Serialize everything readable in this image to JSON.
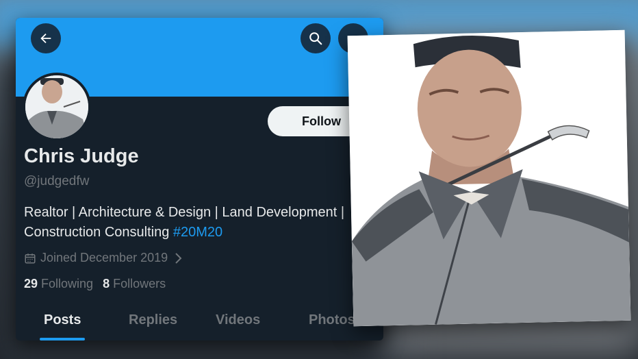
{
  "header": {
    "back_icon": "arrow-left-icon",
    "search_icon": "search-icon",
    "more_icon": "more-horizontal-icon"
  },
  "profile": {
    "follow_label": "Follow",
    "name": "Chris Judge",
    "handle": "@judgedfw",
    "bio_line1": "Realtor | Architecture & Design | Land Development |",
    "bio_line2_text": "Construction Consulting ",
    "bio_hashtag": "#20M20",
    "joined": "Joined December 2019",
    "following_count": "29",
    "following_label": "Following",
    "followers_count": "8",
    "followers_label": "Followers"
  },
  "tabs": [
    {
      "label": "Posts",
      "active": true
    },
    {
      "label": "Replies",
      "active": false
    },
    {
      "label": "Videos",
      "active": false
    },
    {
      "label": "Photos",
      "active": false
    }
  ],
  "colors": {
    "banner": "#1d9bf0",
    "card_bg": "#15202b",
    "accent": "#1d9bf0",
    "text_primary": "#e7e9ea",
    "text_secondary": "#71767b"
  }
}
